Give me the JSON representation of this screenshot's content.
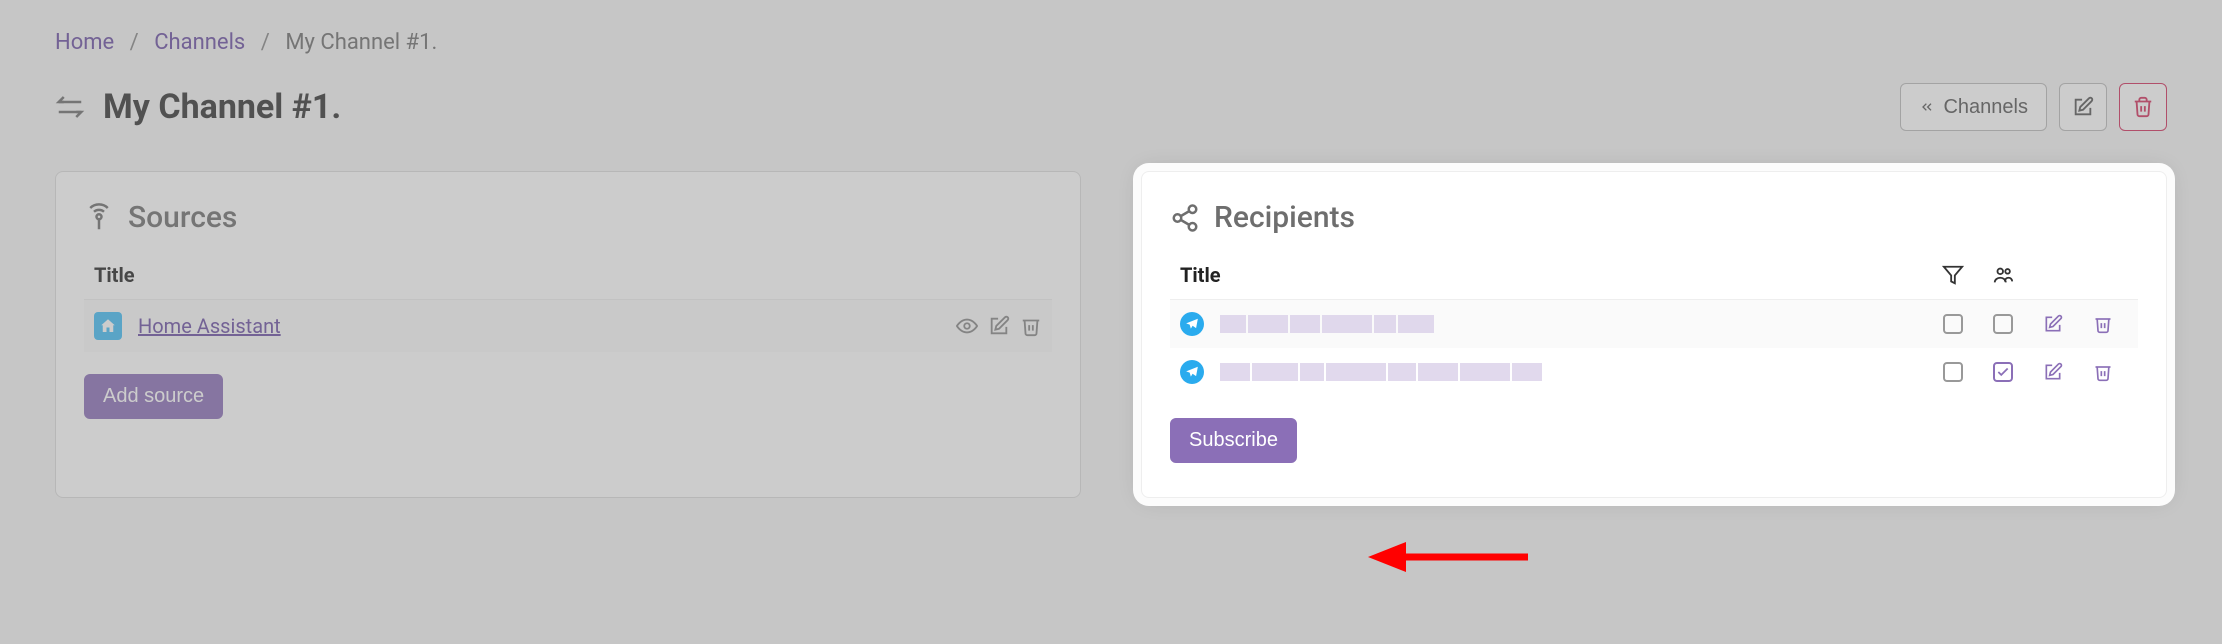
{
  "breadcrumb": {
    "home": "Home",
    "channels": "Channels",
    "current": "My Channel #1."
  },
  "page_title": "My Channel #1.",
  "header_actions": {
    "back_label": "Channels"
  },
  "sources": {
    "heading": "Sources",
    "col_title": "Title",
    "rows": [
      {
        "icon": "home-assistant",
        "title": "Home Assistant"
      }
    ],
    "add_button": "Add source"
  },
  "recipients": {
    "heading": "Recipients",
    "col_title": "Title",
    "rows": [
      {
        "icon": "telegram",
        "redacted": true,
        "filter_checked": false,
        "group_checked": false
      },
      {
        "icon": "telegram",
        "redacted": true,
        "filter_checked": false,
        "group_checked": true
      }
    ],
    "subscribe_button": "Subscribe"
  }
}
